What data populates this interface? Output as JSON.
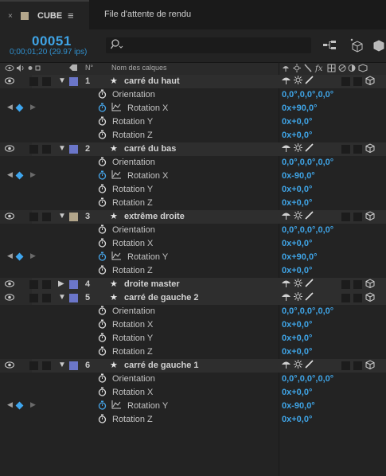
{
  "tabs": {
    "close_glyph": "×",
    "active_title": "CUBE",
    "menu_glyph": "≡",
    "render_queue_title": "File d'attente de rendu"
  },
  "header": {
    "timecode": "00051",
    "timecode_sub": "0;00;01;20 (29.97 ips)",
    "search_icon_glyph": "⌕"
  },
  "columns": {
    "number": "N°",
    "layer_name": "Nom des calques"
  },
  "colors": {
    "blue_label": "#6b76c9",
    "tan_label": "#b2a58a",
    "value_blue": "#3fa4e6"
  },
  "layers": [
    {
      "number": "1",
      "name": "carré du haut",
      "label_color": "#6b76c9",
      "expanded": true,
      "properties": [
        {
          "name": "Orientation",
          "value": "0,0°,0,0°,0,0°",
          "animated": false
        },
        {
          "name": "Rotation X",
          "value": "0x+90,0°",
          "animated": true
        },
        {
          "name": "Rotation Y",
          "value": "0x+0,0°",
          "animated": false
        },
        {
          "name": "Rotation Z",
          "value": "0x+0,0°",
          "animated": false
        }
      ]
    },
    {
      "number": "2",
      "name": "carré du bas",
      "label_color": "#6b76c9",
      "expanded": true,
      "properties": [
        {
          "name": "Orientation",
          "value": "0,0°,0,0°,0,0°",
          "animated": false
        },
        {
          "name": "Rotation X",
          "value": "0x-90,0°",
          "animated": true
        },
        {
          "name": "Rotation Y",
          "value": "0x+0,0°",
          "animated": false
        },
        {
          "name": "Rotation Z",
          "value": "0x+0,0°",
          "animated": false
        }
      ]
    },
    {
      "number": "3",
      "name": "extrême droite",
      "label_color": "#b2a58a",
      "expanded": true,
      "properties": [
        {
          "name": "Orientation",
          "value": "0,0°,0,0°,0,0°",
          "animated": false
        },
        {
          "name": "Rotation X",
          "value": "0x+0,0°",
          "animated": false
        },
        {
          "name": "Rotation Y",
          "value": "0x+90,0°",
          "animated": true
        },
        {
          "name": "Rotation Z",
          "value": "0x+0,0°",
          "animated": false
        }
      ]
    },
    {
      "number": "4",
      "name": "droite master",
      "label_color": "#6b76c9",
      "expanded": false,
      "properties": []
    },
    {
      "number": "5",
      "name": "carré de gauche 2",
      "label_color": "#6b76c9",
      "expanded": true,
      "properties": [
        {
          "name": "Orientation",
          "value": "0,0°,0,0°,0,0°",
          "animated": false
        },
        {
          "name": "Rotation X",
          "value": "0x+0,0°",
          "animated": false
        },
        {
          "name": "Rotation Y",
          "value": "0x+0,0°",
          "animated": false
        },
        {
          "name": "Rotation Z",
          "value": "0x+0,0°",
          "animated": false
        }
      ]
    },
    {
      "number": "6",
      "name": "carré de gauche 1",
      "label_color": "#6b76c9",
      "expanded": true,
      "properties": [
        {
          "name": "Orientation",
          "value": "0,0°,0,0°,0,0°",
          "animated": false
        },
        {
          "name": "Rotation X",
          "value": "0x+0,0°",
          "animated": false
        },
        {
          "name": "Rotation Y",
          "value": "0x-90,0°",
          "animated": true
        },
        {
          "name": "Rotation Z",
          "value": "0x+0,0°",
          "animated": false
        }
      ]
    }
  ]
}
